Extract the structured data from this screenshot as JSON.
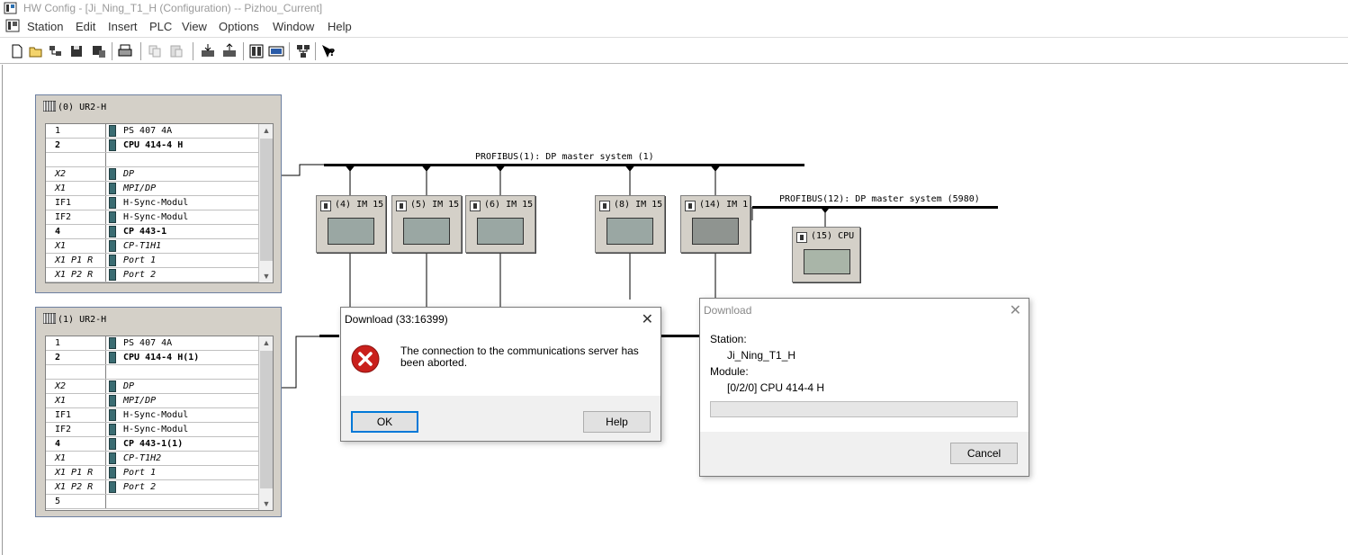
{
  "window": {
    "title": "HW Config - [Ji_Ning_T1_H (Configuration) -- Pizhou_Current]",
    "app_icon": "hw-config-icon"
  },
  "menu": {
    "items": [
      "Station",
      "Edit",
      "Insert",
      "PLC",
      "View",
      "Options",
      "Window",
      "Help"
    ]
  },
  "toolbar": {
    "buttons": [
      "new-icon",
      "open-icon",
      "open-online-icon",
      "save-icon",
      "save-compile-icon",
      "print-icon",
      "copy-icon",
      "paste-icon",
      "download-icon",
      "upload-icon",
      "catalog-icon",
      "rack-view-icon",
      "network-icon",
      "help-icon"
    ]
  },
  "racks": [
    {
      "title": "(0) UR2-H",
      "rows": [
        {
          "slot": "1",
          "name": "PS 407 4A",
          "style": "normal",
          "icon": true
        },
        {
          "slot": "2",
          "name": "CPU 414-4 H",
          "style": "bold",
          "icon": true
        },
        {
          "slot": "",
          "name": "",
          "style": "blank",
          "icon": false
        },
        {
          "slot": "X2",
          "name": "DP",
          "style": "sub",
          "icon": true
        },
        {
          "slot": "X1",
          "name": "MPI/DP",
          "style": "sub",
          "icon": true
        },
        {
          "slot": "IF1",
          "name": "H-Sync-Modul",
          "style": "normal",
          "icon": true
        },
        {
          "slot": "IF2",
          "name": "H-Sync-Modul",
          "style": "normal",
          "icon": true
        },
        {
          "slot": "4",
          "name": "CP 443-1",
          "style": "bold",
          "icon": true
        },
        {
          "slot": "X1",
          "name": "CP-T1H1",
          "style": "sub",
          "icon": true
        },
        {
          "slot": "X1 P1 R",
          "name": "Port 1",
          "style": "sub",
          "icon": true
        },
        {
          "slot": "X1 P2 R",
          "name": "Port 2",
          "style": "sub",
          "icon": true
        }
      ]
    },
    {
      "title": "(1) UR2-H",
      "rows": [
        {
          "slot": "1",
          "name": "PS 407 4A",
          "style": "normal",
          "icon": true
        },
        {
          "slot": "2",
          "name": "CPU 414-4 H(1)",
          "style": "bold",
          "icon": true
        },
        {
          "slot": "",
          "name": "",
          "style": "blank",
          "icon": false
        },
        {
          "slot": "X2",
          "name": "DP",
          "style": "sub",
          "icon": true
        },
        {
          "slot": "X1",
          "name": "MPI/DP",
          "style": "sub",
          "icon": true
        },
        {
          "slot": "IF1",
          "name": "H-Sync-Modul",
          "style": "normal",
          "icon": true
        },
        {
          "slot": "IF2",
          "name": "H-Sync-Modul",
          "style": "normal",
          "icon": true
        },
        {
          "slot": "4",
          "name": "CP 443-1(1)",
          "style": "bold",
          "icon": true
        },
        {
          "slot": "X1",
          "name": "CP-T1H2",
          "style": "sub",
          "icon": true
        },
        {
          "slot": "X1 P1 R",
          "name": "Port 1",
          "style": "sub",
          "icon": true
        },
        {
          "slot": "X1 P2 R",
          "name": "Port 2",
          "style": "sub",
          "icon": true
        },
        {
          "slot": "5",
          "name": "",
          "style": "normal",
          "icon": false
        }
      ]
    }
  ],
  "profibus": {
    "main_label": "PROFIBUS(1): DP master system (1)",
    "sub_label": "PROFIBUS(12): DP master system (5980)",
    "stations": [
      {
        "label": "(4) IM 15"
      },
      {
        "label": "(5) IM 15"
      },
      {
        "label": "(6) IM 15"
      },
      {
        "label": "(8) IM 15"
      },
      {
        "label": "(14) IM 1"
      },
      {
        "label": "(15) CPU"
      }
    ]
  },
  "error_dialog": {
    "title": "Download (33:16399)",
    "message": "The connection to the communications server has been aborted.",
    "ok_label": "OK",
    "help_label": "Help"
  },
  "progress_dialog": {
    "title": "Download",
    "station_label": "Station:",
    "station_value": "Ji_Ning_T1_H",
    "module_label": "Module:",
    "module_value": "[0/2/0] CPU 414-4 H",
    "progress": 0,
    "cancel_label": "Cancel"
  }
}
